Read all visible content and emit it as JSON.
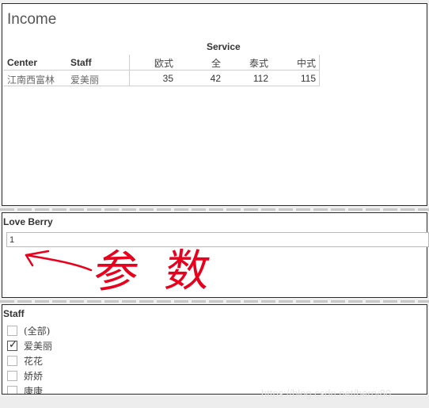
{
  "income": {
    "title": "Income",
    "column_group_header": "Service",
    "row_headers": [
      "Center",
      "Staff"
    ],
    "columns": [
      "欧式",
      "全",
      "泰式",
      "中式"
    ],
    "rows": [
      {
        "center": "江南西富林",
        "staff": "爱美丽",
        "values": [
          "35",
          "42",
          "112",
          "115"
        ]
      }
    ]
  },
  "parameter": {
    "title": "Love Berry",
    "value": "1",
    "annotation_text": [
      "参",
      "数"
    ],
    "annotation_color": "#e8001c"
  },
  "staff_filter": {
    "title": "Staff",
    "items": [
      {
        "label": "(全部)",
        "checked": false
      },
      {
        "label": "爱美丽",
        "checked": true
      },
      {
        "label": "花花",
        "checked": false
      },
      {
        "label": "娇娇",
        "checked": false
      },
      {
        "label": "康康",
        "checked": false
      }
    ]
  },
  "watermark": "https://blog.csdn.net/berry80"
}
